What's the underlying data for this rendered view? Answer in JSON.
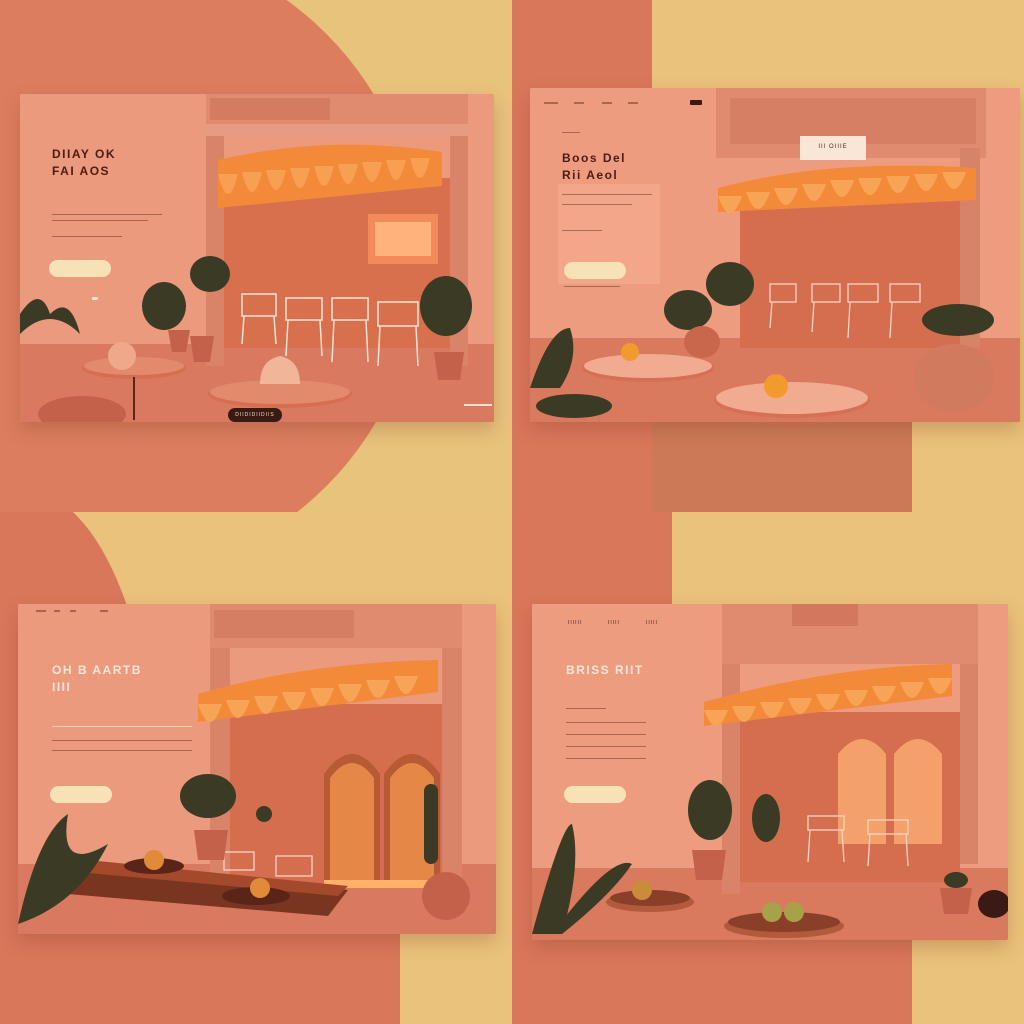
{
  "palette": {
    "terracotta": "#d9775a",
    "sand": "#eac27b",
    "card": "#e9937a",
    "awning": "#f08a3c",
    "ink": "#4a1c12",
    "cream": "#f7e2b6"
  },
  "panels": [
    {
      "headline": [
        "DIIAY OK",
        "FAI AOS"
      ],
      "nav": [],
      "cta": "",
      "badge": "DIIDIDIIDIIS",
      "sign": ""
    },
    {
      "headline": [
        "Boos Del",
        "Rii Aeol"
      ],
      "nav": [],
      "cta": "",
      "badge": "",
      "sign": "III OIIIE"
    },
    {
      "headline": [
        "OH B AARTB",
        "IIII"
      ],
      "nav": [],
      "cta": "",
      "badge": "",
      "sign": ""
    },
    {
      "headline": [
        "BRISS RIIT",
        ""
      ],
      "nav": [
        "IIIIII",
        "IIIII",
        "IIIII"
      ],
      "cta": "",
      "badge": "",
      "sign": ""
    }
  ]
}
